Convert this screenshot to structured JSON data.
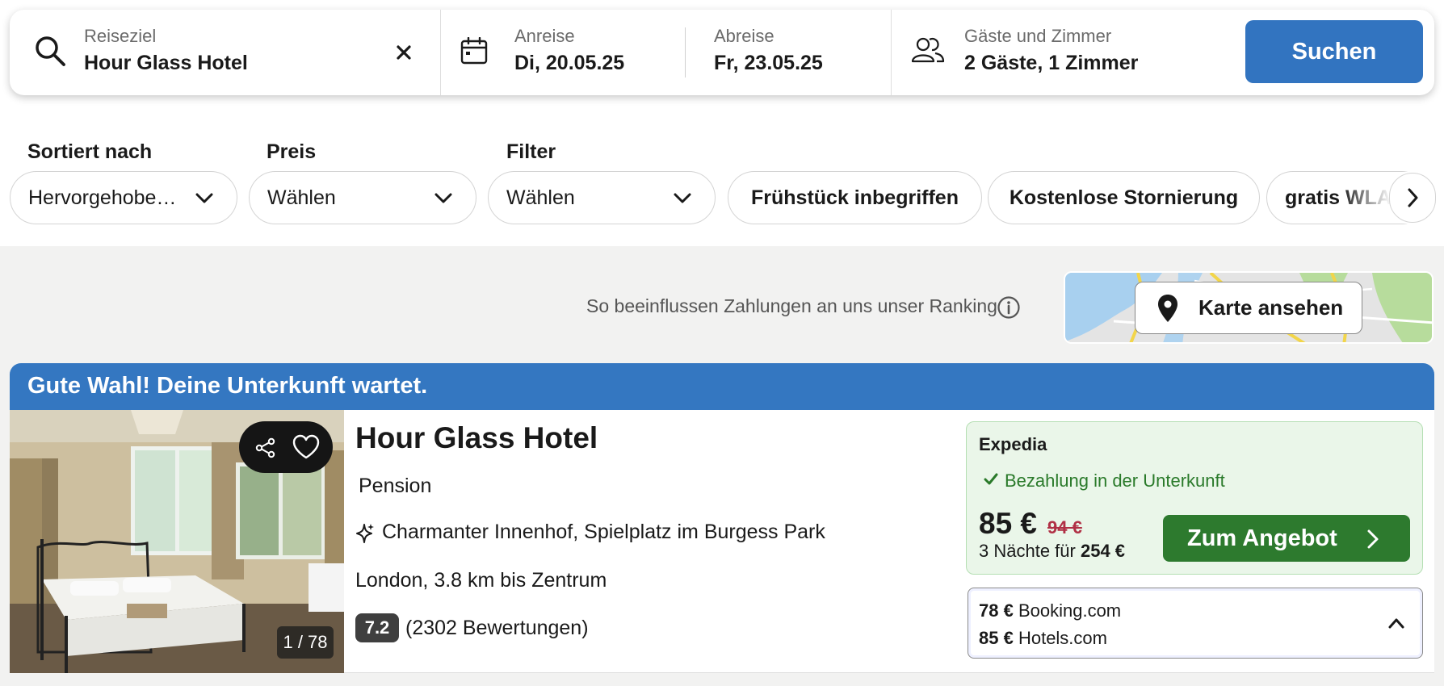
{
  "search": {
    "destination_label": "Reiseziel",
    "destination_value": "Hour Glass Hotel",
    "checkin_label": "Anreise",
    "checkin_value": "Di, 20.05.25",
    "checkout_label": "Abreise",
    "checkout_value": "Fr, 23.05.25",
    "guests_label": "Gäste und Zimmer",
    "guests_value": "2 Gäste, 1 Zimmer",
    "search_button": "Suchen",
    "icons": [
      "search-icon",
      "clear-icon",
      "calendar-icon",
      "guests-icon"
    ]
  },
  "filters": {
    "sort_label": "Sortiert nach",
    "sort_value": "Hervorgehobe…",
    "price_label": "Preis",
    "price_value": "Wählen",
    "filter_label": "Filter",
    "filter_value": "Wählen",
    "chips": [
      "Frühstück inbegriffen",
      "Kostenlose Stornierung",
      "gratis WLAN"
    ]
  },
  "ranking_note": "So beeinflussen Zahlungen an uns unser Ranking",
  "map_button": "Karte ansehen",
  "result": {
    "banner": "Gute Wahl! Deine Unterkunft wartet.",
    "photo_counter": "1 / 78",
    "name": "Hour Glass Hotel",
    "type": "Pension",
    "highlight": "Charmanter Innenhof, Spielplatz im Burgess Park",
    "location": "London, 3.8 km bis Zentrum",
    "rating": "7.2",
    "reviews": "(2302 Bewertungen)",
    "offer": {
      "provider": "Expedia",
      "payment_note": "Bezahlung in der Unterkunft",
      "price": "85 €",
      "old_price": "94 €",
      "total_prefix": "3 Nächte für",
      "total_value": "254 €",
      "button": "Zum Angebot"
    },
    "other_offers": [
      {
        "price": "78 €",
        "provider": "Booking.com"
      },
      {
        "price": "85 €",
        "provider": "Hotels.com"
      }
    ]
  },
  "colors": {
    "primary": "#3274c0",
    "deal": "#2d7a2e",
    "offer_bg": "#eaf6e9",
    "old_price": "#b03045"
  }
}
